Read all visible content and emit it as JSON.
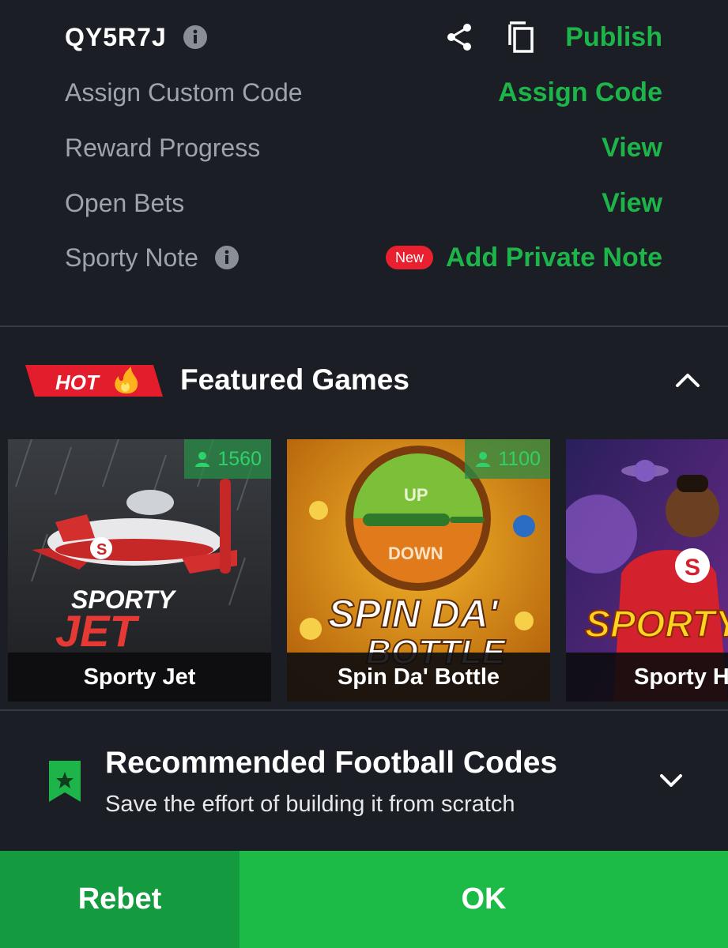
{
  "booking": {
    "code": "QY5R7J",
    "publish_label": "Publish"
  },
  "rows": {
    "assign_label": "Assign Custom Code",
    "assign_action": "Assign Code",
    "reward_label": "Reward Progress",
    "reward_action": "View",
    "openbets_label": "Open Bets",
    "openbets_action": "View",
    "note_label": "Sporty Note",
    "note_badge": "New",
    "note_action": "Add Private Note"
  },
  "featured": {
    "hot_label": "HOT",
    "title": "Featured Games",
    "games": [
      {
        "name": "Sporty Jet",
        "players": "1560",
        "art_title_1": "SPORTY",
        "art_title_2": "JET"
      },
      {
        "name": "Spin Da' Bottle",
        "players": "1100",
        "art_top": "UP",
        "art_bottom": "DOWN",
        "art_title_1": "SPIN DA'",
        "art_title_2": "BOTTLE"
      },
      {
        "name": "Sporty H",
        "art_title_1": "SPORTY H"
      }
    ]
  },
  "recommended": {
    "title": "Recommended Football Codes",
    "subtitle": "Save the effort of building it from scratch"
  },
  "actions": {
    "rebet_label": "Rebet",
    "ok_label": "OK"
  },
  "colors": {
    "background": "#1b1e25",
    "accent_green": "#1db44a",
    "badge_red": "#e8202f",
    "rebet_green": "#149a3f",
    "ok_green": "#1cbb47"
  },
  "icons": [
    "info-icon",
    "share-icon",
    "copy-icon",
    "fire-icon",
    "chevron-up-icon",
    "person-icon",
    "bookmark-star-icon",
    "chevron-down-icon"
  ]
}
